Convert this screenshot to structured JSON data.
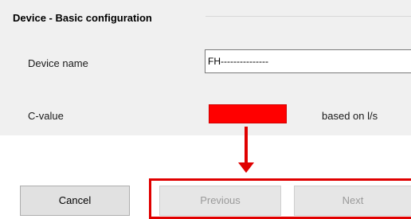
{
  "group": {
    "title": "Device - Basic configuration"
  },
  "fields": {
    "device_name_label": "Device name",
    "device_name_value": "FH---------------",
    "c_value_label": "C-value",
    "c_value_unit": "based on l/s"
  },
  "buttons": {
    "cancel": "Cancel",
    "previous": "Previous",
    "next": "Next"
  },
  "colors": {
    "annotation_red": "#e00000",
    "panel_background": "#f0f0f0",
    "disabled_text": "#9a9a9a"
  }
}
